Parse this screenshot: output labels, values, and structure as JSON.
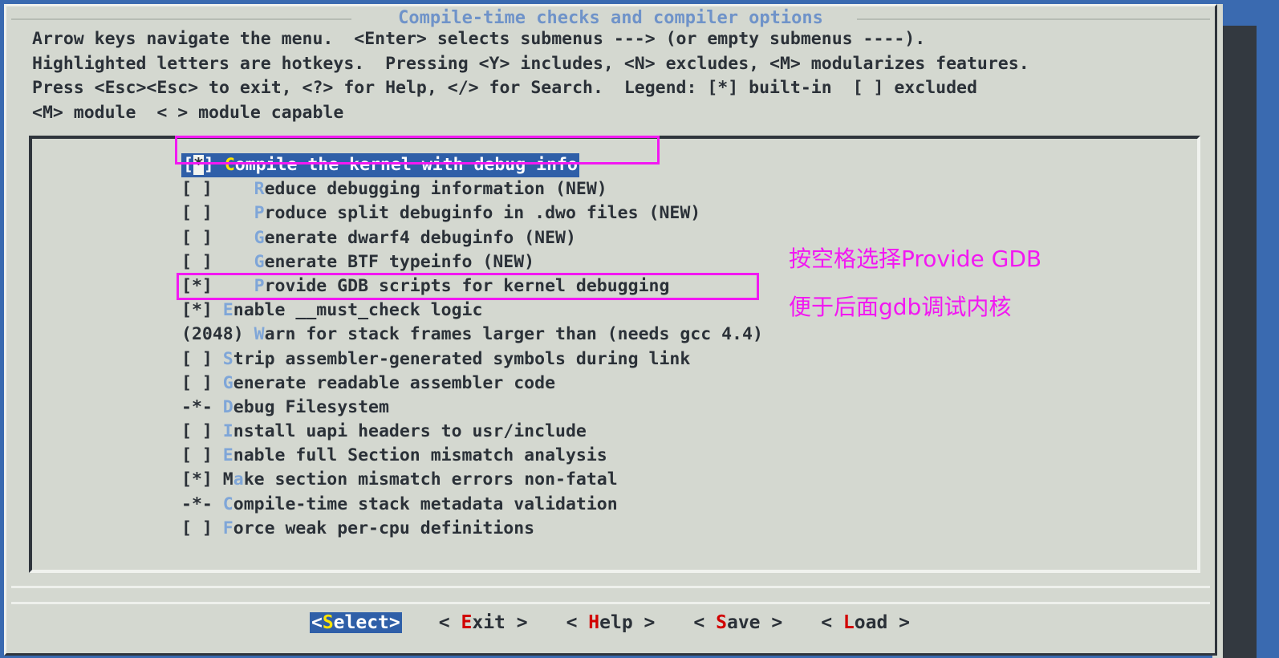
{
  "window": {
    "title": "Compile-time checks and compiler options"
  },
  "help": {
    "lines": [
      "Arrow keys navigate the menu.  <Enter> selects submenus ---> (or empty submenus ----).",
      "Highlighted letters are hotkeys.  Pressing <Y> includes, <N> excludes, <M> modularizes features.",
      "Press <Esc><Esc> to exit, <?> for Help, </> for Search.  Legend: [*] built-in  [ ] excluded",
      "<M> module  < > module capable"
    ]
  },
  "menu": {
    "items": [
      {
        "marker": "[*]",
        "indent": "",
        "hotkey": "C",
        "rest": "ompile the kernel with debug info",
        "selected": true,
        "boxed": true
      },
      {
        "marker": "[ ]",
        "indent": "   ",
        "hotkey": "R",
        "rest": "educe debugging information (NEW)",
        "selected": false,
        "boxed": false
      },
      {
        "marker": "[ ]",
        "indent": "   ",
        "hotkey": "P",
        "rest": "roduce split debuginfo in .dwo files (NEW)",
        "selected": false,
        "boxed": false
      },
      {
        "marker": "[ ]",
        "indent": "   ",
        "hotkey": "G",
        "rest": "enerate dwarf4 debuginfo (NEW)",
        "selected": false,
        "boxed": false
      },
      {
        "marker": "[ ]",
        "indent": "   ",
        "hotkey": "G",
        "rest": "enerate BTF typeinfo (NEW)",
        "selected": false,
        "boxed": false
      },
      {
        "marker": "[*]",
        "indent": "   ",
        "hotkey": "P",
        "rest": "rovide GDB scripts for kernel debugging",
        "selected": false,
        "boxed": true
      },
      {
        "marker": "[*]",
        "indent": "",
        "hotkey": "E",
        "rest": "nable __must_check logic",
        "selected": false,
        "boxed": false
      },
      {
        "marker": "(2048)",
        "indent": "",
        "hotkey": "W",
        "rest": "arn for stack frames larger than (needs gcc 4.4)",
        "selected": false,
        "boxed": false
      },
      {
        "marker": "[ ]",
        "indent": "",
        "hotkey": "S",
        "rest": "trip assembler-generated symbols during link",
        "selected": false,
        "boxed": false
      },
      {
        "marker": "[ ]",
        "indent": "",
        "hotkey": "G",
        "rest": "enerate readable assembler code",
        "selected": false,
        "boxed": false
      },
      {
        "marker": "-*-",
        "indent": "",
        "hotkey": "D",
        "rest": "ebug Filesystem",
        "selected": false,
        "boxed": false
      },
      {
        "marker": "[ ]",
        "indent": "",
        "hotkey": "I",
        "rest": "nstall uapi headers to usr/include",
        "selected": false,
        "boxed": false
      },
      {
        "marker": "[ ]",
        "indent": "",
        "hotkey": "E",
        "rest": "nable full Section mismatch analysis",
        "selected": false,
        "boxed": false
      },
      {
        "marker": "[*]",
        "indent": "",
        "prefix": "M",
        "hotkey": "a",
        "rest": "ke section mismatch errors non-fatal",
        "selected": false,
        "boxed": false
      },
      {
        "marker": "-*-",
        "indent": "",
        "hotkey": "C",
        "rest": "ompile-time stack metadata validation",
        "selected": false,
        "boxed": false
      },
      {
        "marker": "[ ]",
        "indent": "",
        "hotkey": "F",
        "rest": "orce weak per-cpu definitions",
        "selected": false,
        "boxed": false
      }
    ]
  },
  "annotations": {
    "line1": "按空格选择Provide GDB",
    "line2": "便于后面gdb调试内核",
    "color": "#f218f2"
  },
  "buttons": [
    {
      "open": "<",
      "hotkey": "S",
      "rest": "elect",
      "close": ">",
      "active": true,
      "spaced": false
    },
    {
      "open": "<",
      "hotkey": "E",
      "rest": "xit",
      "close": ">",
      "active": false,
      "spaced": true
    },
    {
      "open": "<",
      "hotkey": "H",
      "rest": "elp",
      "close": ">",
      "active": false,
      "spaced": true
    },
    {
      "open": "<",
      "hotkey": "S",
      "rest": "ave",
      "close": ">",
      "active": false,
      "spaced": true
    },
    {
      "open": "<",
      "hotkey": "L",
      "rest": "oad",
      "close": ">",
      "active": false,
      "spaced": true
    }
  ],
  "colors": {
    "background": "#d4d8d0",
    "title": "#6f93c9",
    "hotkey": "#7fa6d8",
    "selection_bg": "#2f5fa8",
    "selection_hotkey": "#ffe400",
    "button_hotkey": "#d10000",
    "annotation": "#f218f2",
    "desktop": "#3a6ab0"
  }
}
